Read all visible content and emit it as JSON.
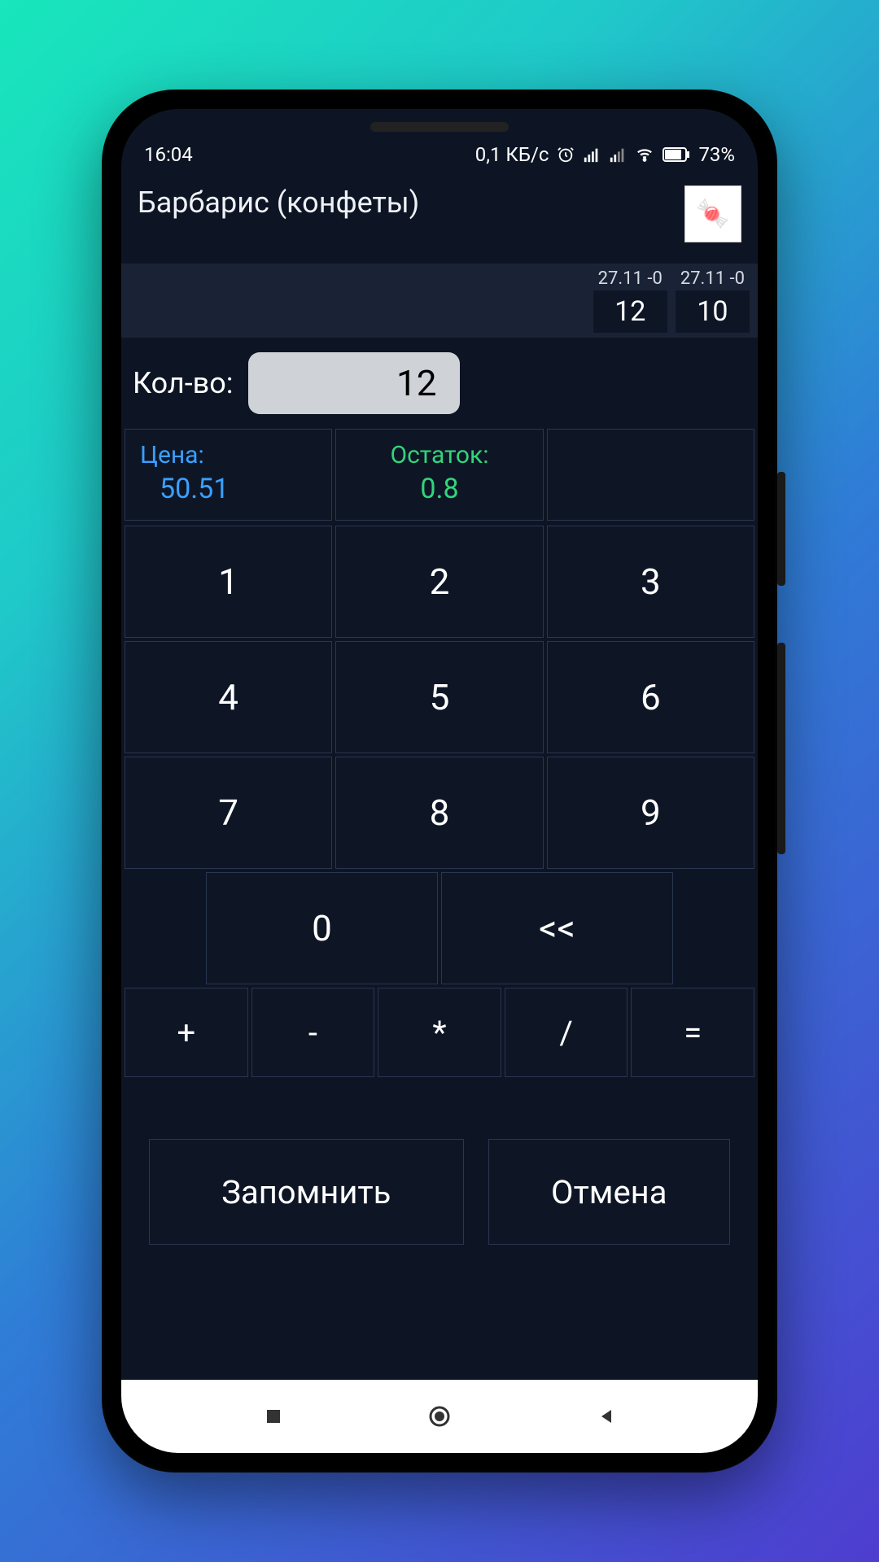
{
  "statusbar": {
    "time": "16:04",
    "net_speed": "0,1 КБ/с",
    "battery_pct": "73%"
  },
  "title": "Барбарис (конфеты)",
  "product_icon": "candy-bag",
  "history": [
    {
      "date": "27.11 -0",
      "value": "12"
    },
    {
      "date": "27.11 -0",
      "value": "10"
    }
  ],
  "quantity": {
    "label": "Кол-во:",
    "value": "12"
  },
  "info": {
    "price_label": "Цена:",
    "price_value": "50.51",
    "remainder_label": "Остаток:",
    "remainder_value": "0.8"
  },
  "keypad": {
    "d1": "1",
    "d2": "2",
    "d3": "3",
    "d4": "4",
    "d5": "5",
    "d6": "6",
    "d7": "7",
    "d8": "8",
    "d9": "9",
    "d0": "0",
    "back": "<<",
    "plus": "+",
    "minus": "-",
    "mul": "*",
    "div": "/",
    "eq": "="
  },
  "actions": {
    "save": "Запомнить",
    "cancel": "Отмена"
  }
}
